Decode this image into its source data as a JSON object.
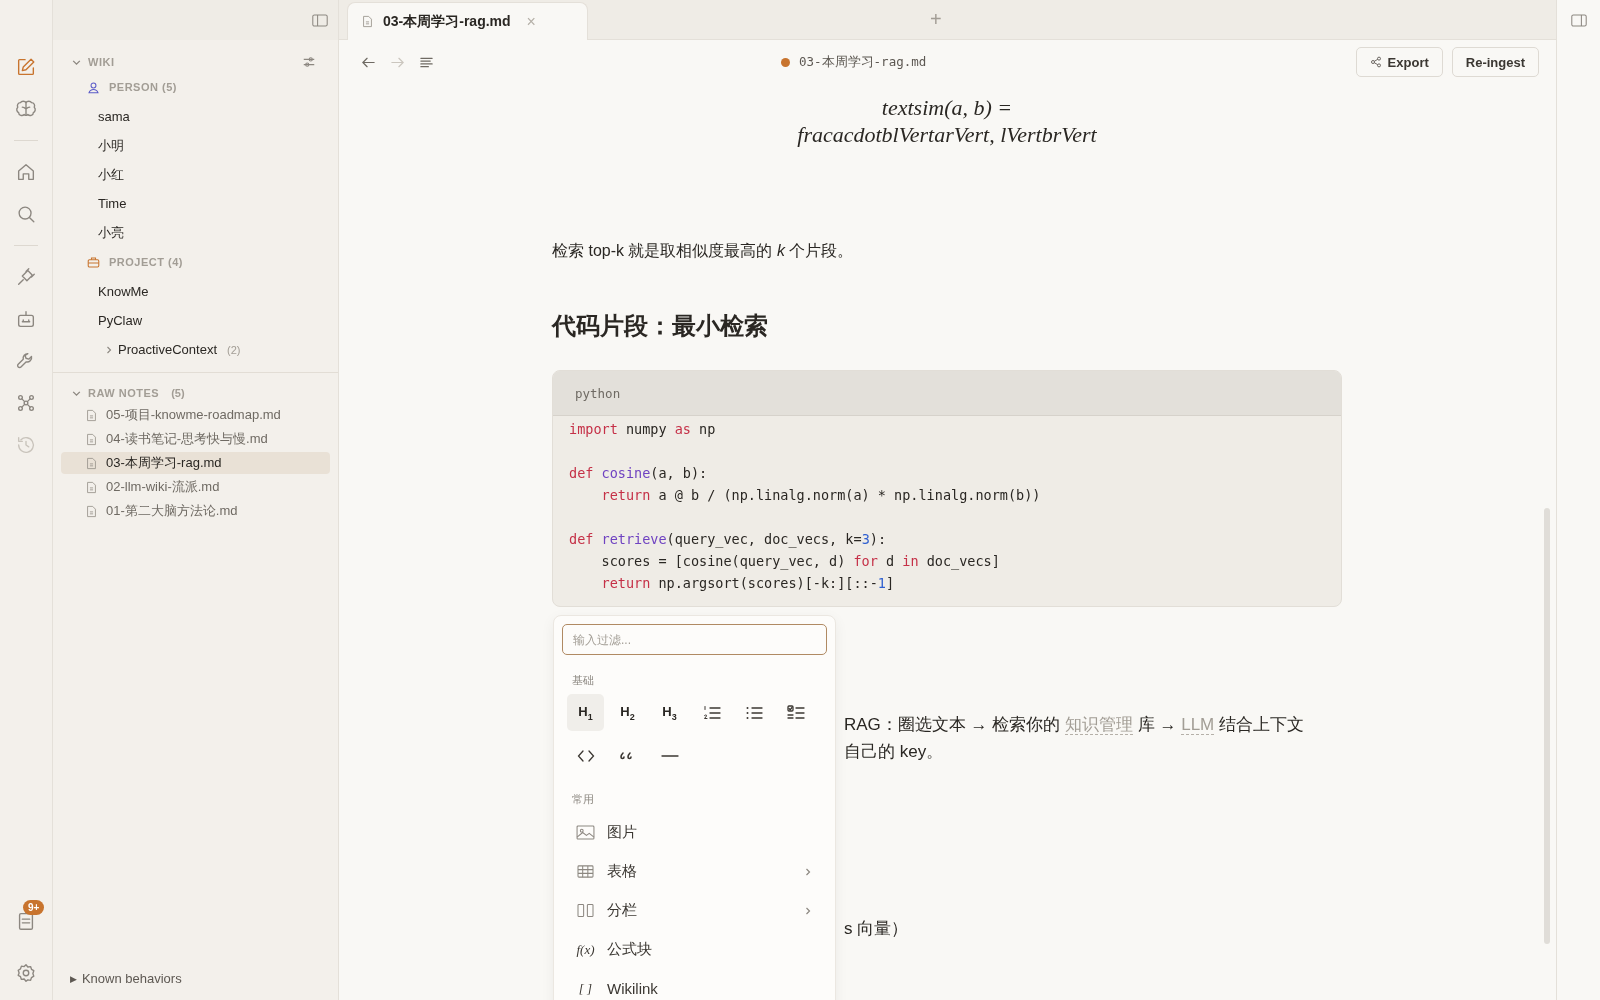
{
  "rail": {
    "top": [
      {
        "kind": "edit",
        "selected": true
      },
      {
        "kind": "brain",
        "selected": false
      },
      {
        "kind": "divider"
      },
      {
        "kind": "home",
        "selected": false
      },
      {
        "kind": "search",
        "selected": false
      },
      {
        "kind": "divider"
      },
      {
        "kind": "plug",
        "selected": false
      },
      {
        "kind": "robot",
        "selected": false
      },
      {
        "kind": "wrench",
        "selected": false
      },
      {
        "kind": "graph",
        "selected": false
      },
      {
        "kind": "history",
        "selected": false
      }
    ],
    "notifications_badge": "9+"
  },
  "sidebar": {
    "wiki": {
      "title": "WIKI",
      "expanded": true,
      "groups": [
        {
          "kind": "person",
          "title": "PERSON (5)",
          "items": [
            {
              "label": "sama"
            },
            {
              "label": "小明"
            },
            {
              "label": "小红"
            },
            {
              "label": "Time"
            },
            {
              "label": "小亮"
            }
          ]
        },
        {
          "kind": "project",
          "title": "PROJECT (4)",
          "items": [
            {
              "label": "KnowMe"
            },
            {
              "label": "PyClaw"
            },
            {
              "label": "ProactiveContext",
              "count": "(2)",
              "expanded": false
            }
          ]
        }
      ]
    },
    "raw_notes": {
      "title": "RAW NOTES",
      "count": "(5)",
      "expanded": true,
      "files": [
        {
          "label": "05-项目-knowme-roadmap.md",
          "selected": false
        },
        {
          "label": "04-读书笔记-思考快与慢.md",
          "selected": false
        },
        {
          "label": "03-本周学习-rag.md",
          "selected": true
        },
        {
          "label": "02-llm-wiki-流派.md",
          "selected": false
        },
        {
          "label": "01-第二大脑方法论.md",
          "selected": false
        }
      ]
    },
    "footer": {
      "marker": "▶",
      "label": "Known behaviors"
    }
  },
  "tabs": [
    {
      "title": "03-本周学习-rag.md",
      "close": "×",
      "selected": true
    }
  ],
  "new_tab": "+",
  "toolbar": {
    "back_disabled": false,
    "forward_disabled": true,
    "file": "03-本周学习-rag.md",
    "unsaved": true,
    "buttons": [
      {
        "kind": "share",
        "label": "Export"
      },
      {
        "kind": "plain",
        "label": "Re-ingest"
      }
    ]
  },
  "document": {
    "formula": [
      "textsim(a, b) =",
      "fracacdotblVertarVert, lVertbrVert"
    ],
    "paragraph": "检索 top-k 就是取相似度最高的 *k* 个片段。",
    "heading": "代码片段：最小检索",
    "code": {
      "language": "python",
      "lines": [
        {
          "kind": "code",
          "tokens": [
            {
              "t": "import",
              "kind": "keyword"
            },
            {
              "t": " numpy ",
              "kind": "plain"
            },
            {
              "t": "as",
              "kind": "keyword"
            },
            {
              "t": " np",
              "kind": "plain"
            }
          ]
        },
        {
          "kind": "blank"
        },
        {
          "kind": "code",
          "tokens": [
            {
              "t": "def",
              "kind": "keyword"
            },
            {
              "t": " cosine",
              "kind": "function"
            },
            {
              "t": "(a, b):",
              "kind": "plain"
            }
          ]
        },
        {
          "kind": "code",
          "tokens": [
            {
              "t": "    return",
              "kind": "keyword"
            },
            {
              "t": " a @ b / (np.linalg.norm(a) * np.linalg.norm(b))",
              "kind": "plain"
            }
          ]
        },
        {
          "kind": "blank"
        },
        {
          "kind": "code",
          "tokens": [
            {
              "t": "def",
              "kind": "keyword"
            },
            {
              "t": " retrieve",
              "kind": "function"
            },
            {
              "t": "(query_vec, doc_vecs, k=",
              "kind": "plain"
            },
            {
              "t": "3",
              "kind": "number"
            },
            {
              "t": "):",
              "kind": "plain"
            }
          ]
        },
        {
          "kind": "code",
          "tokens": [
            {
              "t": "    scores = [cosine(query_vec, d) ",
              "kind": "plain"
            },
            {
              "t": "for",
              "kind": "keyword"
            },
            {
              "t": " d ",
              "kind": "plain"
            },
            {
              "t": "in",
              "kind": "keyword"
            },
            {
              "t": " doc_vecs]",
              "kind": "plain"
            }
          ]
        },
        {
          "kind": "code",
          "tokens": [
            {
              "t": "    return",
              "kind": "keyword"
            },
            {
              "t": " np.argsort(scores)[-k:][::-",
              "kind": "plain"
            },
            {
              "t": "1",
              "kind": "number"
            },
            {
              "t": "]",
              "kind": "plain"
            }
          ]
        }
      ]
    },
    "partly_hidden_lines": [
      {
        "gap_before": false,
        "parts": [
          {
            "t": "RAG：圈选文本 → 检索你的 ",
            "link": false
          },
          {
            "t": "知识管理",
            "link": true
          },
          {
            "t": " 库 → ",
            "link": false
          },
          {
            "t": "LLM",
            "link": true
          },
          {
            "t": " 结合上下文",
            "link": false
          }
        ]
      },
      {
        "gap_before": false,
        "parts": [
          {
            "t": "自己的 key。",
            "link": false
          }
        ]
      },
      {
        "gap_before": true,
        "parts": [
          {
            "t": "s 向量）",
            "link": false
          }
        ]
      }
    ]
  },
  "slash_menu": {
    "filter": {
      "placeholder": "输入过滤..."
    },
    "sections": [
      {
        "title": "基础",
        "kind": "grid",
        "items": [
          {
            "kind": "heading",
            "label": "H$_{1}$",
            "selected": true
          },
          {
            "kind": "heading",
            "label": "H$_{2}$",
            "selected": false
          },
          {
            "kind": "heading",
            "label": "H$_{3}$",
            "selected": false
          },
          {
            "kind": "ordered",
            "selected": false
          },
          {
            "kind": "bullet",
            "selected": false
          },
          {
            "kind": "task",
            "selected": false
          },
          {
            "kind": "code",
            "selected": false
          },
          {
            "kind": "quote",
            "selected": false
          },
          {
            "kind": "rule",
            "selected": false
          }
        ]
      },
      {
        "title": "常用",
        "kind": "list",
        "items": [
          {
            "kind": "image",
            "label": "图片",
            "submenu": false
          },
          {
            "kind": "table",
            "label": "表格",
            "submenu": true
          },
          {
            "kind": "columns",
            "label": "分栏",
            "submenu": true
          },
          {
            "kind": "glyph",
            "glyph": "f(x)",
            "label": "公式块",
            "submenu": false
          },
          {
            "kind": "glyph",
            "glyph": "[ ]",
            "label": "Wikilink",
            "submenu": false
          }
        ]
      }
    ]
  }
}
